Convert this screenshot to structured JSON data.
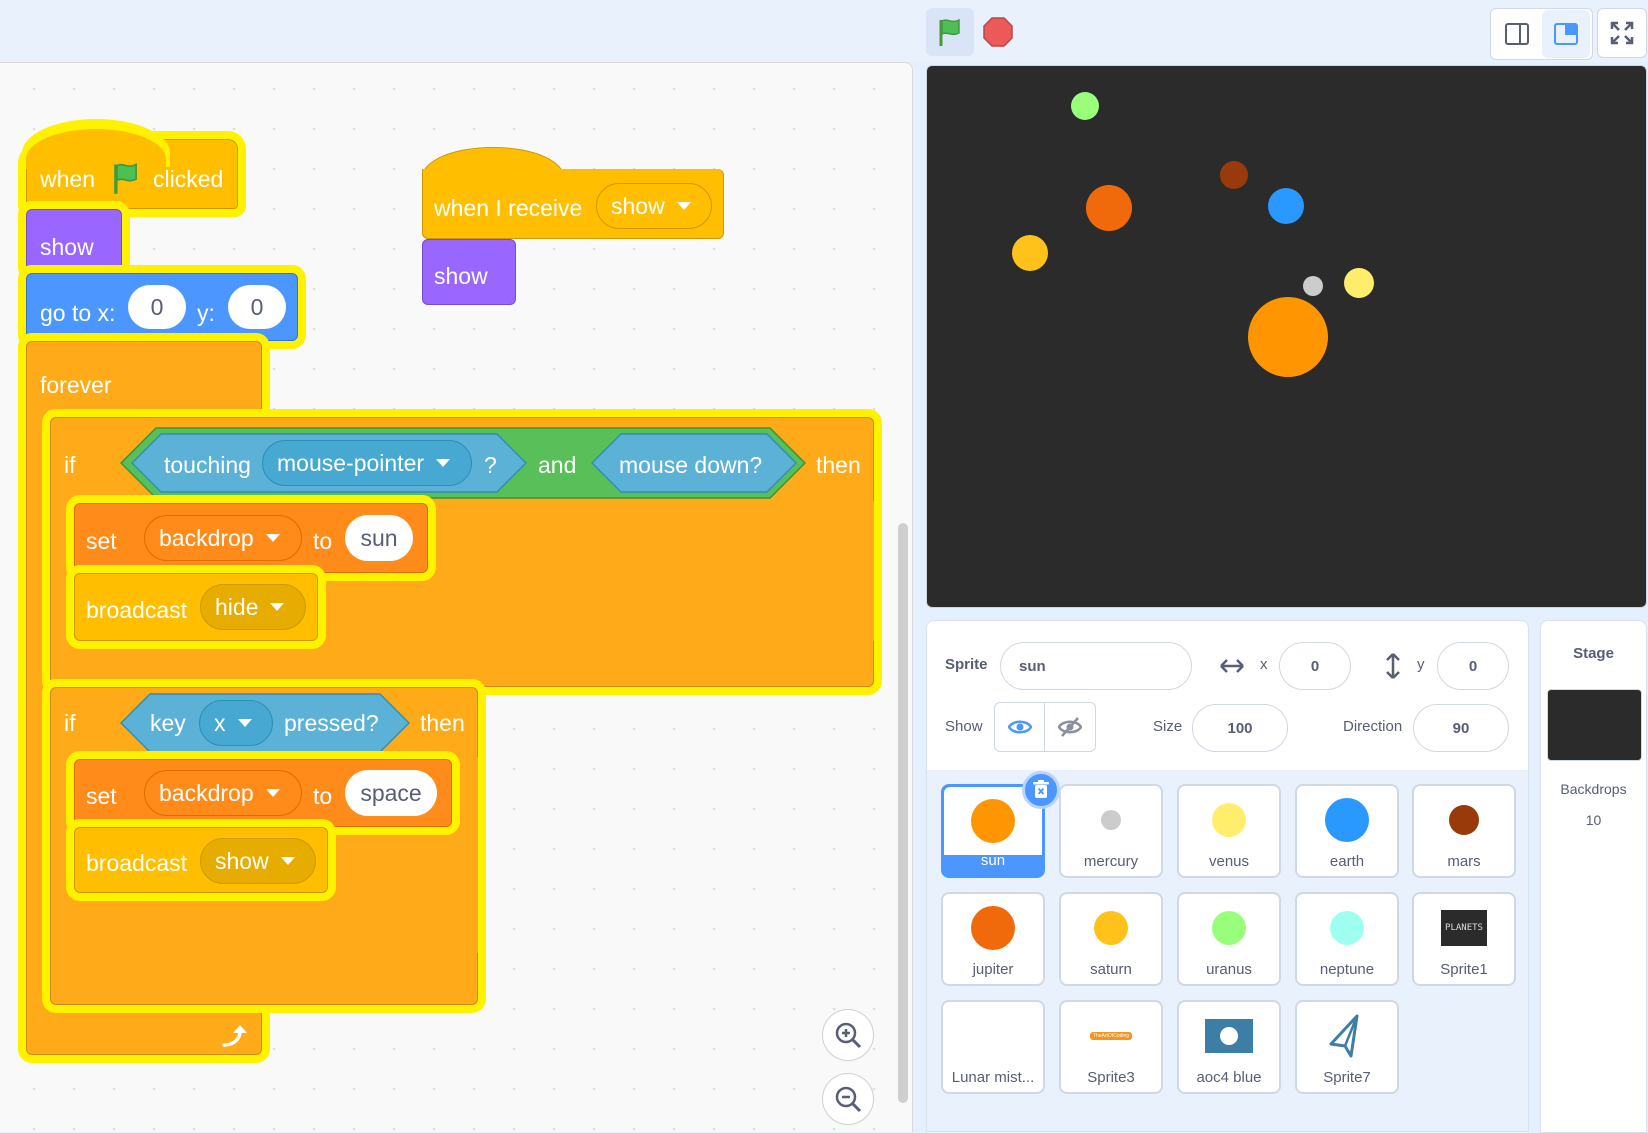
{
  "colors": {
    "events": "#ffbf00",
    "looks": "#9966ff",
    "motion": "#4c97ff",
    "control": "#ffab19",
    "operators": "#59c059",
    "sensing": "#5cb1d6",
    "glow": "#fff200",
    "accent": "#4c97ff"
  },
  "script1": {
    "hat_when": "when",
    "hat_clicked": "clicked",
    "show": "show",
    "goto_label": "go to x:",
    "goto_x": "0",
    "goto_y_label": "y:",
    "goto_y": "0",
    "forever": "forever",
    "if1": {
      "if_label": "if",
      "touching": "touching",
      "touching_target": "mouse-pointer",
      "question": "?",
      "and": "and",
      "mouse_down": "mouse down?",
      "then": "then",
      "set_label": "set",
      "set_target": "backdrop",
      "to_label": "to",
      "set_value": "sun",
      "broadcast_label": "broadcast",
      "broadcast_msg": "hide"
    },
    "if2": {
      "if_label": "if",
      "key_label": "key",
      "key_value": "x",
      "pressed": "pressed?",
      "then": "then",
      "set_label": "set",
      "set_target": "backdrop",
      "to_label": "to",
      "set_value": "space",
      "broadcast_label": "broadcast",
      "broadcast_msg": "show"
    }
  },
  "script2": {
    "hat_label": "when I receive",
    "hat_msg": "show",
    "show": "show"
  },
  "stage_planets": [
    {
      "name": "uranus",
      "color": "#99ff7a"
    },
    {
      "name": "mars",
      "color": "#993a0a"
    },
    {
      "name": "jupiter",
      "color": "#f06a0c"
    },
    {
      "name": "earth",
      "color": "#2998ff"
    },
    {
      "name": "saturn",
      "color": "#ffc21a"
    },
    {
      "name": "mercury",
      "color": "#cccccc"
    },
    {
      "name": "venus",
      "color": "#ffee6b"
    },
    {
      "name": "sun",
      "color": "#ff9500"
    }
  ],
  "sprite_info": {
    "sprite_label": "Sprite",
    "sprite_name": "sun",
    "x_label": "x",
    "x_value": "0",
    "y_label": "y",
    "y_value": "0",
    "show_label": "Show",
    "size_label": "Size",
    "size_value": "100",
    "direction_label": "Direction",
    "direction_value": "90"
  },
  "sprites": [
    {
      "name": "sun",
      "color": "#ff9500",
      "selected": true
    },
    {
      "name": "mercury",
      "color": "#cccccc"
    },
    {
      "name": "venus",
      "color": "#ffee6b"
    },
    {
      "name": "earth",
      "color": "#2998ff"
    },
    {
      "name": "mars",
      "color": "#993a0a"
    },
    {
      "name": "jupiter",
      "color": "#f06a0c"
    },
    {
      "name": "saturn",
      "color": "#ffc21a"
    },
    {
      "name": "uranus",
      "color": "#99ff7a"
    },
    {
      "name": "neptune",
      "color": "#9efff0"
    },
    {
      "name": "Sprite1",
      "thumb_text": "PLANETS"
    },
    {
      "name": "Lunar mist..."
    },
    {
      "name": "Sprite3",
      "thumb_text": "TheArtOfCoding"
    },
    {
      "name": "aoc4 blue"
    },
    {
      "name": "Sprite7"
    }
  ],
  "stage_panel": {
    "title": "Stage",
    "backdrops_label": "Backdrops",
    "backdrops_count": "10"
  }
}
